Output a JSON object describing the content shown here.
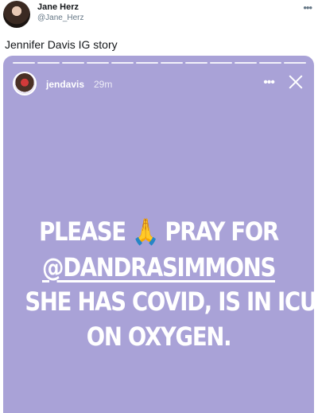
{
  "tweet": {
    "display_name": "Jane Herz",
    "handle": "@Jane_Herz",
    "more_icon": "more-dots-icon",
    "text": "Jennifer Davis IG story"
  },
  "story": {
    "username": "jendavis",
    "time": "29m",
    "more_icon": "more-dots-icon",
    "close_icon": "close-icon",
    "background_color": "#a9a2d7",
    "progress_segments": 12,
    "lines": {
      "line1_part1": "PLEASE",
      "emoji": "🙏",
      "line1_part2": "PRAY FOR",
      "mention": "@DANDRASIMMONS",
      "line3": "SHE HAS COVID, IS IN ICU",
      "line4": "ON OXYGEN."
    }
  }
}
